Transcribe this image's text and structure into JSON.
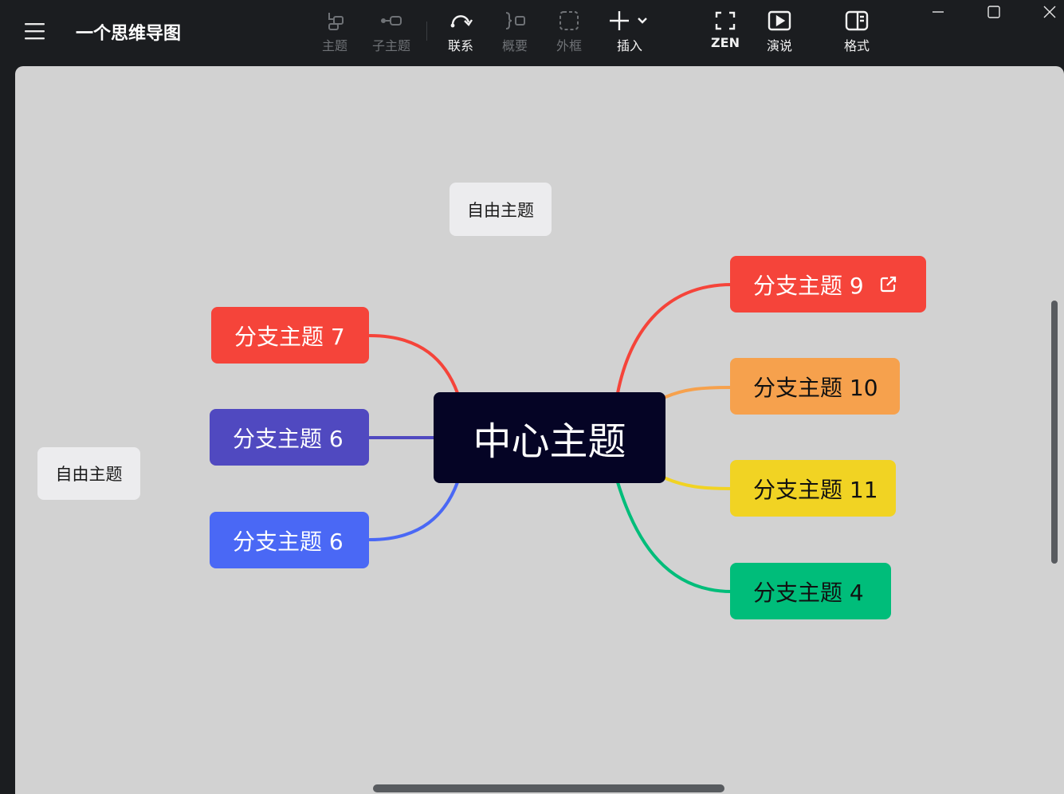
{
  "app": {
    "title": "一个思维导图"
  },
  "toolbar": {
    "topic": "主题",
    "subtopic": "子主题",
    "relationship": "联系",
    "summary": "概要",
    "boundary": "外框",
    "insert": "插入",
    "zen": "ZEN",
    "presentation": "演说",
    "format": "格式"
  },
  "mindmap": {
    "central": "中心主题",
    "left_branches": [
      "分支主题 7",
      "分支主题 6",
      "分支主题 6"
    ],
    "right_branches": [
      "分支主题 9",
      "分支主题 10",
      "分支主题 11",
      "分支主题 4"
    ],
    "floating": [
      "自由主题",
      "自由主题"
    ]
  },
  "colors": {
    "red": "#f5443a",
    "indigo": "#5049c0",
    "blue": "#4a68f5",
    "orange": "#f6a14d",
    "yellow": "#f1d323",
    "green": "#00bd7a",
    "central_bg": "#050425",
    "canvas": "#d2d2d2",
    "titlebar": "#1b1d20"
  }
}
